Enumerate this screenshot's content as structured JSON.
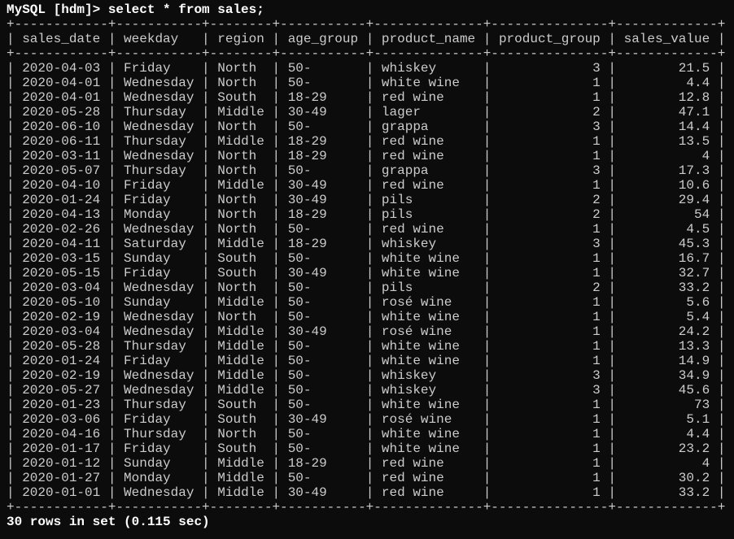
{
  "terminal": {
    "prompt": "MySQL [hdm]>",
    "command": "select * from sales;",
    "status": "30 rows in set (0.115 sec)"
  },
  "table": {
    "columns": [
      "sales_date",
      "weekday",
      "region",
      "age_group",
      "product_name",
      "product_group",
      "sales_value"
    ],
    "rows": [
      [
        "2020-04-03",
        "Friday",
        "North",
        "50-",
        "whiskey",
        "3",
        "21.5"
      ],
      [
        "2020-04-01",
        "Wednesday",
        "North",
        "50-",
        "white wine",
        "1",
        "4.4"
      ],
      [
        "2020-04-01",
        "Wednesday",
        "South",
        "18-29",
        "red wine",
        "1",
        "12.8"
      ],
      [
        "2020-05-28",
        "Thursday",
        "Middle",
        "30-49",
        "lager",
        "2",
        "47.1"
      ],
      [
        "2020-06-10",
        "Wednesday",
        "North",
        "50-",
        "grappa",
        "3",
        "14.4"
      ],
      [
        "2020-06-11",
        "Thursday",
        "Middle",
        "18-29",
        "red wine",
        "1",
        "13.5"
      ],
      [
        "2020-03-11",
        "Wednesday",
        "North",
        "18-29",
        "red wine",
        "1",
        "4"
      ],
      [
        "2020-05-07",
        "Thursday",
        "North",
        "50-",
        "grappa",
        "3",
        "17.3"
      ],
      [
        "2020-04-10",
        "Friday",
        "Middle",
        "30-49",
        "red wine",
        "1",
        "10.6"
      ],
      [
        "2020-01-24",
        "Friday",
        "North",
        "30-49",
        "pils",
        "2",
        "29.4"
      ],
      [
        "2020-04-13",
        "Monday",
        "North",
        "18-29",
        "pils",
        "2",
        "54"
      ],
      [
        "2020-02-26",
        "Wednesday",
        "North",
        "50-",
        "red wine",
        "1",
        "4.5"
      ],
      [
        "2020-04-11",
        "Saturday",
        "Middle",
        "18-29",
        "whiskey",
        "3",
        "45.3"
      ],
      [
        "2020-03-15",
        "Sunday",
        "South",
        "50-",
        "white wine",
        "1",
        "16.7"
      ],
      [
        "2020-05-15",
        "Friday",
        "South",
        "30-49",
        "white wine",
        "1",
        "32.7"
      ],
      [
        "2020-03-04",
        "Wednesday",
        "North",
        "50-",
        "pils",
        "2",
        "33.2"
      ],
      [
        "2020-05-10",
        "Sunday",
        "Middle",
        "50-",
        "rosé wine",
        "1",
        "5.6"
      ],
      [
        "2020-02-19",
        "Wednesday",
        "North",
        "50-",
        "white wine",
        "1",
        "5.4"
      ],
      [
        "2020-03-04",
        "Wednesday",
        "Middle",
        "30-49",
        "rosé wine",
        "1",
        "24.2"
      ],
      [
        "2020-05-28",
        "Thursday",
        "Middle",
        "50-",
        "white wine",
        "1",
        "13.3"
      ],
      [
        "2020-01-24",
        "Friday",
        "Middle",
        "50-",
        "white wine",
        "1",
        "14.9"
      ],
      [
        "2020-02-19",
        "Wednesday",
        "Middle",
        "50-",
        "whiskey",
        "3",
        "34.9"
      ],
      [
        "2020-05-27",
        "Wednesday",
        "Middle",
        "50-",
        "whiskey",
        "3",
        "45.6"
      ],
      [
        "2020-01-23",
        "Thursday",
        "South",
        "50-",
        "white wine",
        "1",
        "73"
      ],
      [
        "2020-03-06",
        "Friday",
        "South",
        "30-49",
        "rosé wine",
        "1",
        "5.1"
      ],
      [
        "2020-04-16",
        "Thursday",
        "North",
        "50-",
        "white wine",
        "1",
        "4.4"
      ],
      [
        "2020-01-17",
        "Friday",
        "South",
        "50-",
        "white wine",
        "1",
        "23.2"
      ],
      [
        "2020-01-12",
        "Sunday",
        "Middle",
        "18-29",
        "red wine",
        "1",
        "4"
      ],
      [
        "2020-01-27",
        "Monday",
        "Middle",
        "50-",
        "red wine",
        "1",
        "30.2"
      ],
      [
        "2020-01-01",
        "Wednesday",
        "Middle",
        "30-49",
        "red wine",
        "1",
        "33.2"
      ]
    ]
  }
}
